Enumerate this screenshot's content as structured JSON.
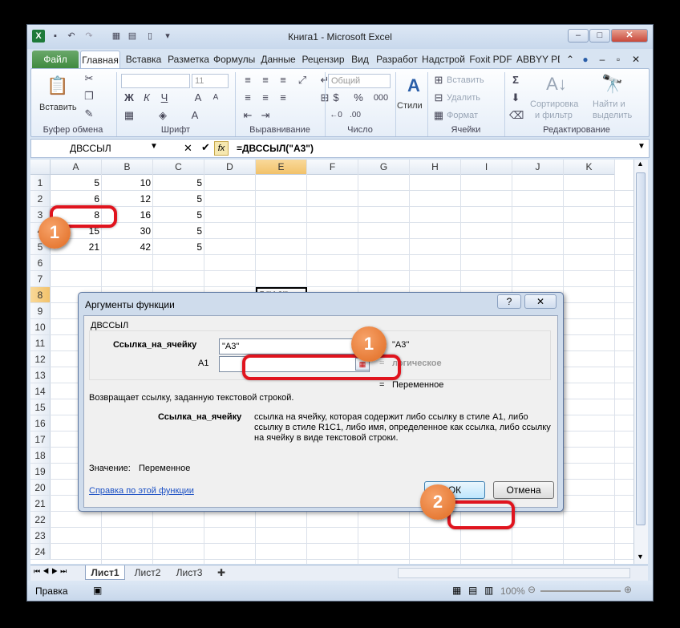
{
  "title": "Книга1  -  Microsoft Excel",
  "tabs": [
    "Файл",
    "Главная",
    "Вставка",
    "Разметка",
    "Формулы",
    "Данные",
    "Рецензир",
    "Вид",
    "Разработ",
    "Надстрой",
    "Foxit PDF",
    "ABBYY PD"
  ],
  "ribbon": {
    "clipboard": {
      "paste": "Вставить",
      "label": "Буфер обмена"
    },
    "font": {
      "size": "11",
      "bold": "Ж",
      "italic": "К",
      "underline": "Ч",
      "label": "Шрифт"
    },
    "alignment": {
      "label": "Выравнивание"
    },
    "number": {
      "format": "Общий",
      "percent": "%",
      "thousands": "000",
      "label": "Число"
    },
    "styles": {
      "label": "Стили"
    },
    "cells": {
      "insert": "Вставить",
      "delete": "Удалить",
      "format": "Формат",
      "label": "Ячейки"
    },
    "editing": {
      "sort": "Сортировка",
      "sort2": "и фильтр",
      "find": "Найти и",
      "find2": "выделить",
      "label": "Редактирование"
    }
  },
  "formula_bar": {
    "name_box": "ДВССЫЛ",
    "formula": "=ДВССЫЛ(\"A3\")",
    "fx": "fx"
  },
  "columns": [
    "A",
    "B",
    "C",
    "D",
    "E",
    "F",
    "G",
    "H",
    "I",
    "J",
    "K"
  ],
  "rows": [
    "1",
    "2",
    "3",
    "4",
    "5",
    "6",
    "7",
    "8",
    "9",
    "10",
    "11",
    "12",
    "13",
    "14",
    "15",
    "16",
    "17",
    "18",
    "19",
    "20",
    "21",
    "22",
    "23",
    "24"
  ],
  "cells": {
    "r1": [
      "5",
      "10",
      "5"
    ],
    "r2": [
      "6",
      "12",
      "5"
    ],
    "r3": [
      "8",
      "16",
      "5"
    ],
    "r4": [
      "15",
      "30",
      "5"
    ],
    "r5": [
      "21",
      "42",
      "5"
    ],
    "e8": "Л(\"A3\")"
  },
  "sheets": [
    "Лист1",
    "Лист2",
    "Лист3"
  ],
  "status": {
    "ready": "Правка",
    "zoom": "100%"
  },
  "dialog": {
    "title": "Аргументы функции",
    "help_q": "?",
    "function_name": "ДВССЫЛ",
    "arg1_label": "Ссылка_на_ячейку",
    "arg1_value": "\"A3\"",
    "arg1_result": "\"A3\"",
    "arg2_label": "A1",
    "arg2_result": "логическое",
    "eq": "=",
    "result": "Переменное",
    "description": "Возвращает ссылку, заданную текстовой строкой.",
    "arg_desc_name": "Ссылка_на_ячейку",
    "arg_desc_lines": [
      "ссылка на ячейку, которая содержит либо ссылку в стиле A1, либо",
      "ссылку в стиле R1C1, либо имя, определенное как ссылка, либо ссылку",
      "на ячейку в виде текстовой строки."
    ],
    "value_label": "Значение:",
    "value": "Переменное",
    "help_link": "Справка по этой функции",
    "ok": "ОК",
    "cancel": "Отмена"
  },
  "callouts": [
    "1",
    "1",
    "2"
  ]
}
